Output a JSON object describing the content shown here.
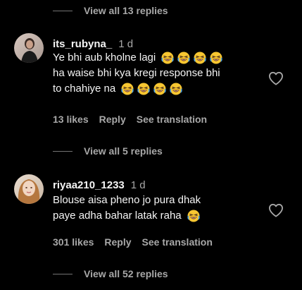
{
  "top_replies": {
    "label": "View all 13 replies"
  },
  "comments": [
    {
      "username": "its_rubyna_",
      "time_ago": "1 d",
      "line1": "Ye bhi aub kholne lagi",
      "line2": "ha waise bhi kya kregi response bhi",
      "line3": "to chahiye na",
      "emoji_name": "rolling-on-the-floor-laughing",
      "likes": "13 likes",
      "reply_label": "Reply",
      "translation_label": "See translation",
      "view_replies": "View all 5 replies"
    },
    {
      "username": "riyaa210_1233",
      "time_ago": "1 d",
      "line1": "Blouse aisa pheno jo pura dhak",
      "line2": "paye adha bahar latak raha",
      "emoji_name": "rolling-on-the-floor-laughing",
      "likes": "301 likes",
      "reply_label": "Reply",
      "translation_label": "See translation",
      "view_replies": "View all 52 replies"
    }
  ],
  "colors": {
    "background": "#000000",
    "primary_text": "#f5f5f5",
    "secondary_text": "#a8a8a8",
    "divider": "#737373"
  },
  "icons": {
    "like": "heart-outline-icon",
    "emoji": "laughing-emoji"
  }
}
